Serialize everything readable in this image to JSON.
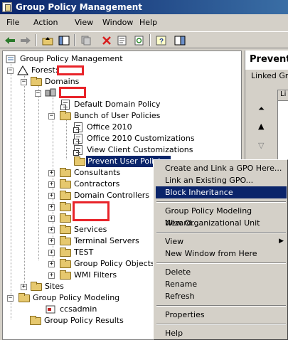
{
  "window": {
    "title": "Group Policy Management"
  },
  "menu": [
    "File",
    "Action",
    "View",
    "Window",
    "Help"
  ],
  "toolbar": {
    "buttons": [
      "back-arrow-icon",
      "forward-arrow-icon",
      "up-folder-icon",
      "show-hide-tree-icon",
      "copy-icon",
      "delete-icon",
      "properties-icon",
      "refresh-icon",
      "help-icon",
      "show-pane-icon"
    ]
  },
  "tree": {
    "root": "Group Policy Management",
    "forest": "Forest:",
    "domains": "Domains",
    "default_domain_policy": "Default Domain Policy",
    "bunch_of_user_policies": "Bunch of User Policies",
    "office_2010": "Office 2010",
    "office_2010_customizations": "Office 2010 Customizations",
    "view_client_customizations": "View Client Customizations",
    "prevent_user_policies": "Prevent User Policies",
    "consultants": "Consultants",
    "contractors": "Contractors",
    "domain_controllers": "Domain Controllers",
    "services": "Services",
    "terminal_servers": "Terminal Servers",
    "test": "TEST",
    "group_policy_objects": "Group Policy Objects",
    "wmi_filters": "WMI Filters",
    "sites": "Sites",
    "group_policy_modeling": "Group Policy Modeling",
    "ccsadmin": "ccsadmin",
    "group_policy_results": "Group Policy Results"
  },
  "right_pane": {
    "title": "Prevent",
    "linked": "Linked Gr",
    "col_header": "Li"
  },
  "context_menu": {
    "create_link": "Create and Link a GPO Here...",
    "link_existing": "Link an Existing GPO...",
    "block_inheritance": "Block Inheritance",
    "modeling_wizard": "Group Policy Modeling Wizard...",
    "new_ou": "New Organizational Unit",
    "view": "View",
    "new_window": "New Window from Here",
    "delete": "Delete",
    "rename": "Rename",
    "refresh": "Refresh",
    "properties": "Properties",
    "help": "Help"
  },
  "colors": {
    "selection": "#0a246a",
    "redaction": "#e8242a",
    "title_gradient_start": "#0a246a",
    "title_gradient_end": "#3a6ea5"
  }
}
